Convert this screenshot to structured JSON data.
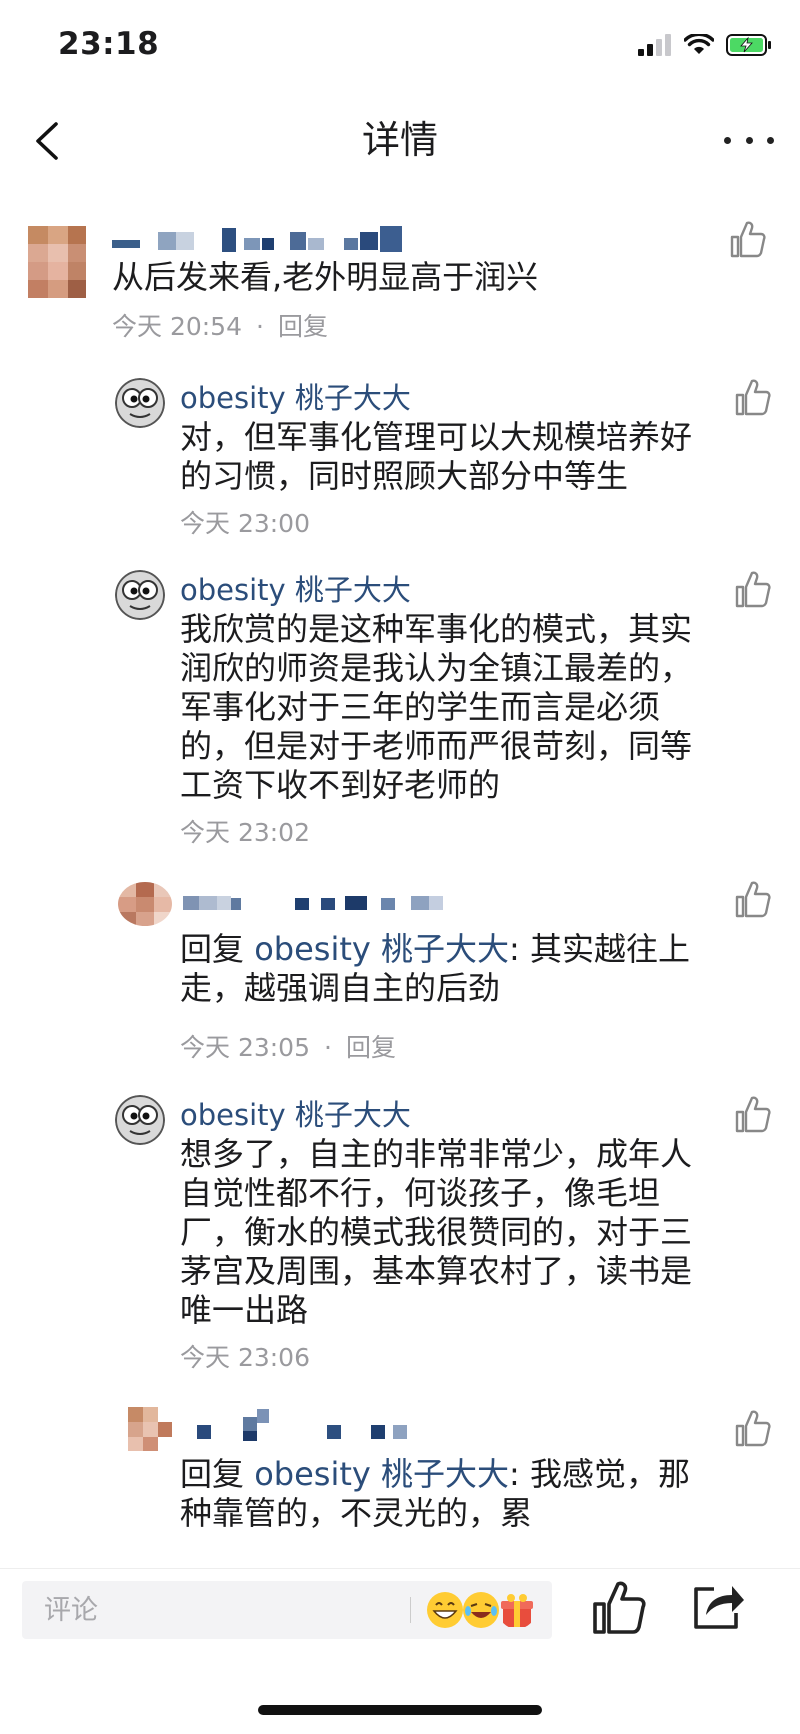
{
  "status_bar": {
    "time": "23:18"
  },
  "nav": {
    "title": "详情"
  },
  "comments": [
    {
      "text": "从后发来看,老外明显高于润兴",
      "time": "今天 20:54",
      "reply_label": "回复"
    },
    {
      "author": "obesity 桃子大大",
      "text": "对，但军事化管理可以大规模培养好的习惯，同时照顾大部分中等生",
      "time": "今天 23:00"
    },
    {
      "author": "obesity 桃子大大",
      "text": "我欣赏的是这种军事化的模式，其实润欣的师资是我认为全镇江最差的，军事化对于三年的学生而言是必须的，但是对于老师而严很苛刻，同等工资下收不到好老师的",
      "time": "今天 23:02"
    },
    {
      "reply_prefix": "回复",
      "reply_to": "obesity 桃子大大",
      "reply_text": ": 其实越往上走，越强调自主的后劲",
      "time": "今天 23:05",
      "reply_label": "回复"
    },
    {
      "author": "obesity 桃子大大",
      "text": "想多了，自主的非常非常少，成年人自觉性都不行，何谈孩子，像毛坦厂，衡水的模式我很赞同的，对于三茅宫及周围，基本算农村了，读书是唯一出路",
      "time": "今天 23:06"
    },
    {
      "reply_prefix": "回复",
      "reply_to": "obesity 桃子大大",
      "reply_text": ": 我感觉，那种靠管的，不灵光的，累"
    }
  ],
  "bottom_bar": {
    "comment_placeholder": "评论"
  },
  "colors": {
    "link": "#2b4d7a",
    "meta": "#9a9a9e",
    "text": "#1c1c1e"
  }
}
